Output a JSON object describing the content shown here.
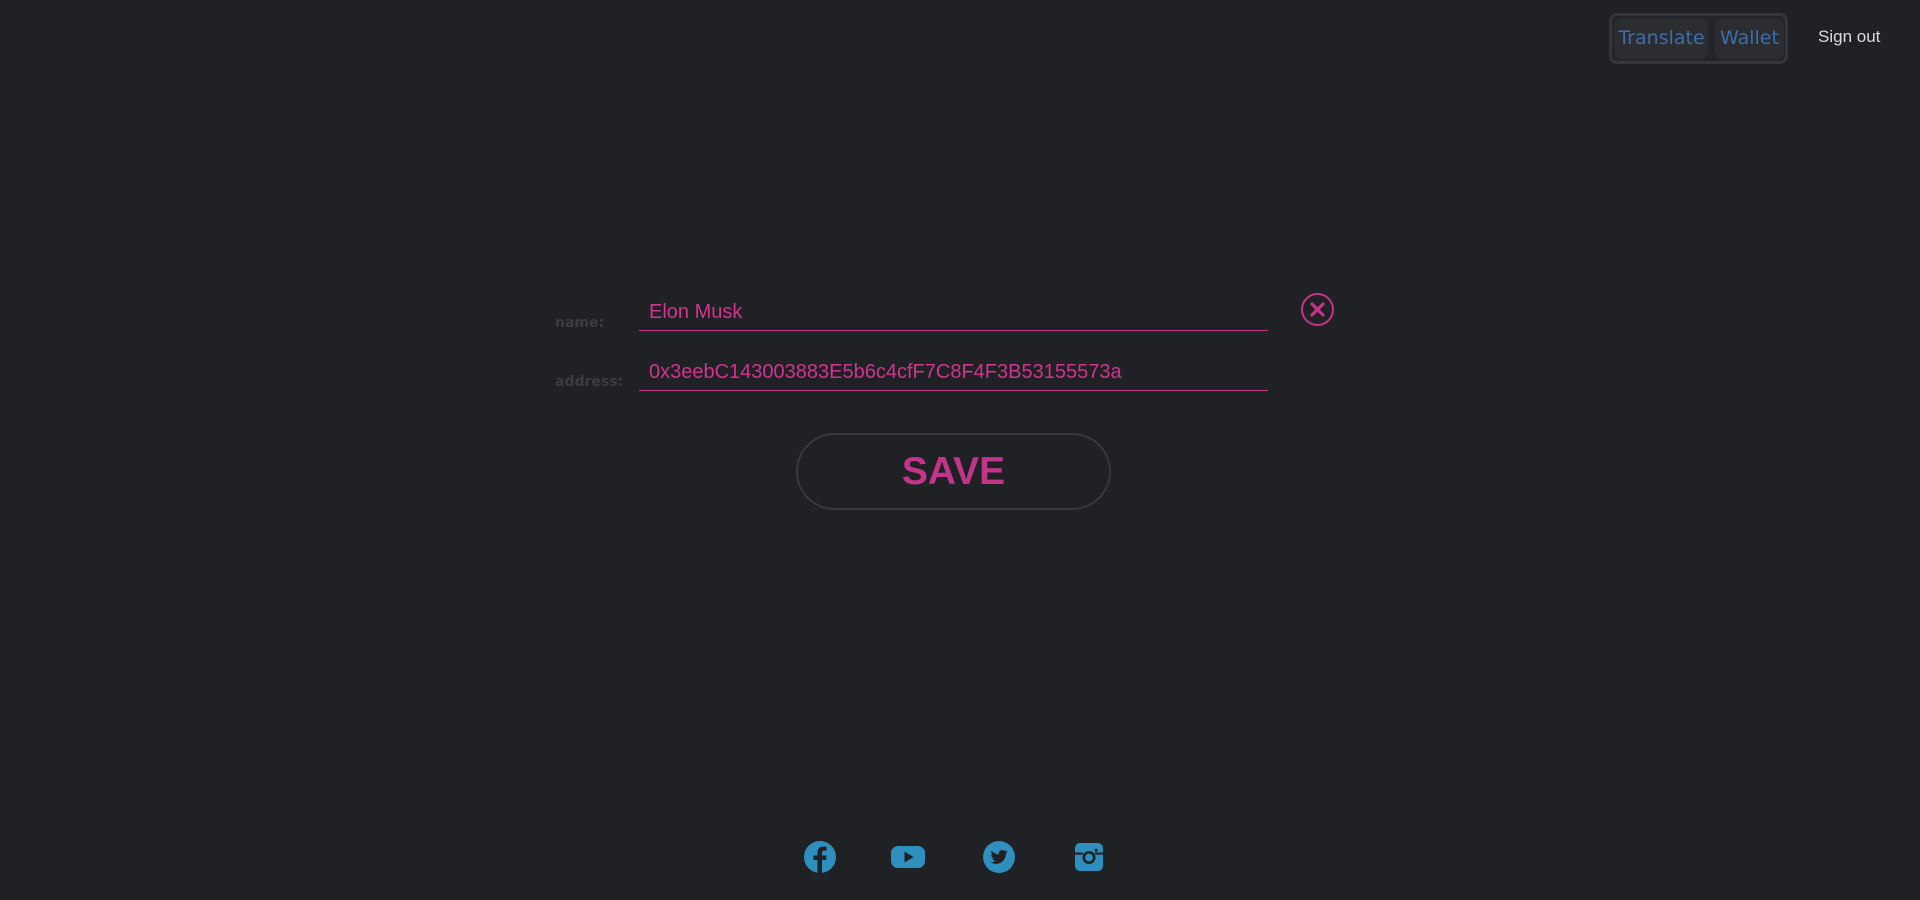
{
  "header": {
    "nav": [
      {
        "label": "Translate"
      },
      {
        "label": "Wallet"
      }
    ],
    "sign_out_label": "Sign out"
  },
  "form": {
    "name_label": "name:",
    "name_value": "Elon Musk",
    "address_label": "address:",
    "address_value": "0x3eebC143003883E5b6c4cfF7C8F4F3B53155573a",
    "save_label": "SAVE",
    "close_icon": "close-circle-icon"
  },
  "footer": {
    "social_icons": [
      "facebook-icon",
      "youtube-icon",
      "twitter-icon",
      "instagram-icon"
    ]
  },
  "colors": {
    "background": "#202125",
    "accent": "#c2358a",
    "nav_text": "#3d6ea8",
    "social": "#2f8fbf"
  }
}
